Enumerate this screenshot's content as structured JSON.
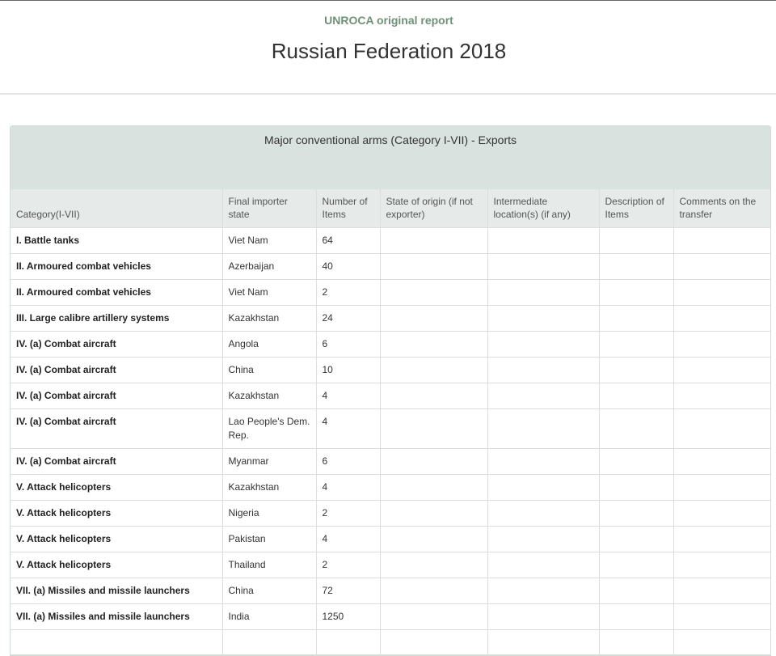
{
  "header": {
    "kicker": "UNROCA original report",
    "title": "Russian Federation 2018"
  },
  "panel": {
    "heading": "Major conventional arms (Category I-VII) - Exports"
  },
  "table": {
    "columns": [
      "Category(I-VII)",
      "Final importer state",
      "Number of Items",
      "State of origin (if not exporter)",
      "Intermediate location(s) (if any)",
      "Description of Items",
      "Comments on the transfer"
    ],
    "rows": [
      [
        "I. Battle tanks",
        "Viet Nam",
        "64",
        "",
        "",
        "",
        ""
      ],
      [
        "II. Armoured combat vehicles",
        "Azerbaijan",
        "40",
        "",
        "",
        "",
        ""
      ],
      [
        "II. Armoured combat vehicles",
        "Viet Nam",
        "2",
        "",
        "",
        "",
        ""
      ],
      [
        "III. Large calibre artillery systems",
        "Kazakhstan",
        "24",
        "",
        "",
        "",
        ""
      ],
      [
        "IV. (a) Combat aircraft",
        "Angola",
        "6",
        "",
        "",
        "",
        ""
      ],
      [
        "IV. (a) Combat aircraft",
        "China",
        "10",
        "",
        "",
        "",
        ""
      ],
      [
        "IV. (a) Combat aircraft",
        "Kazakhstan",
        "4",
        "",
        "",
        "",
        ""
      ],
      [
        "IV. (a) Combat aircraft",
        "Lao People's Dem. Rep.",
        "4",
        "",
        "",
        "",
        ""
      ],
      [
        "IV. (a) Combat aircraft",
        "Myanmar",
        "6",
        "",
        "",
        "",
        ""
      ],
      [
        "V. Attack helicopters",
        "Kazakhstan",
        "4",
        "",
        "",
        "",
        ""
      ],
      [
        "V. Attack helicopters",
        "Nigeria",
        "2",
        "",
        "",
        "",
        ""
      ],
      [
        "V. Attack helicopters",
        "Pakistan",
        "4",
        "",
        "",
        "",
        ""
      ],
      [
        "V. Attack helicopters",
        "Thailand",
        "2",
        "",
        "",
        "",
        ""
      ],
      [
        "VII. (a) Missiles and missile launchers",
        "China",
        "72",
        "",
        "",
        "",
        ""
      ],
      [
        "VII. (a) Missiles and missile launchers",
        "India",
        "1250",
        "",
        "",
        "",
        ""
      ],
      [
        "",
        "",
        "",
        "",
        "",
        "",
        ""
      ]
    ]
  }
}
